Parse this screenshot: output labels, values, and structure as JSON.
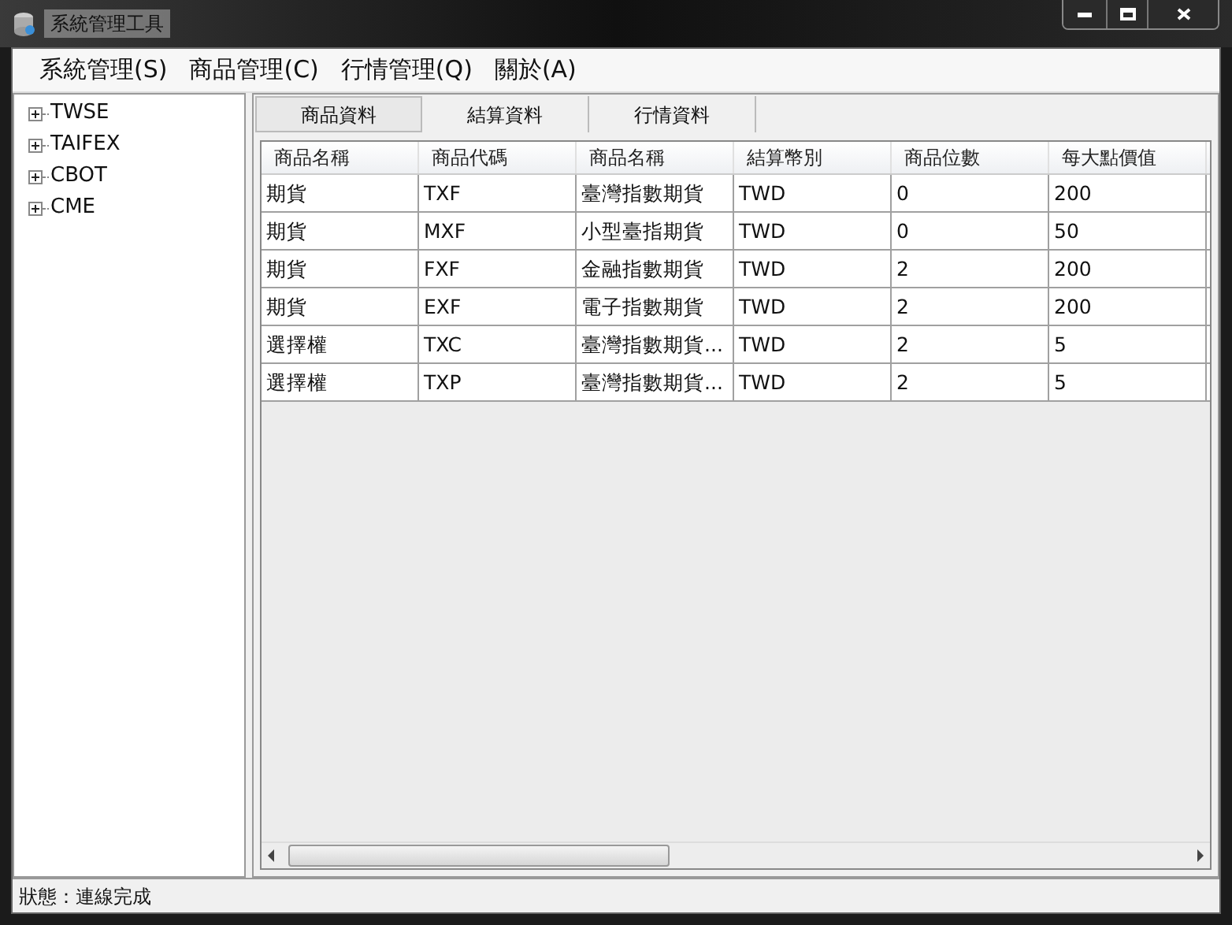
{
  "window": {
    "title": "系統管理工具"
  },
  "menu": [
    "系統管理(S)",
    "商品管理(C)",
    "行情管理(Q)",
    "關於(A)"
  ],
  "tree": [
    {
      "label": "TWSE",
      "expanded": false
    },
    {
      "label": "TAIFEX",
      "expanded": false
    },
    {
      "label": "CBOT",
      "expanded": false
    },
    {
      "label": "CME",
      "expanded": false
    }
  ],
  "tabs": [
    {
      "label": "商品資料",
      "selected": true
    },
    {
      "label": "結算資料",
      "selected": false
    },
    {
      "label": "行情資料",
      "selected": false
    }
  ],
  "table": {
    "columns": [
      "商品名稱",
      "商品代碼",
      "商品名稱",
      "結算幣別",
      "商品位數",
      "每大點價值"
    ],
    "rows": [
      [
        "期貨",
        "TXF",
        "臺灣指數期貨",
        "TWD",
        "0",
        "200"
      ],
      [
        "期貨",
        "MXF",
        "小型臺指期貨",
        "TWD",
        "0",
        "50"
      ],
      [
        "期貨",
        "FXF",
        "金融指數期貨",
        "TWD",
        "2",
        "200"
      ],
      [
        "期貨",
        "EXF",
        "電子指數期貨",
        "TWD",
        "2",
        "200"
      ],
      [
        "選擇權",
        "TXC",
        "臺灣指數期貨...",
        "TWD",
        "2",
        "5"
      ],
      [
        "選擇權",
        "TXP",
        "臺灣指數期貨...",
        "TWD",
        "2",
        "5"
      ]
    ]
  },
  "status_bar": "狀態：連線完成"
}
